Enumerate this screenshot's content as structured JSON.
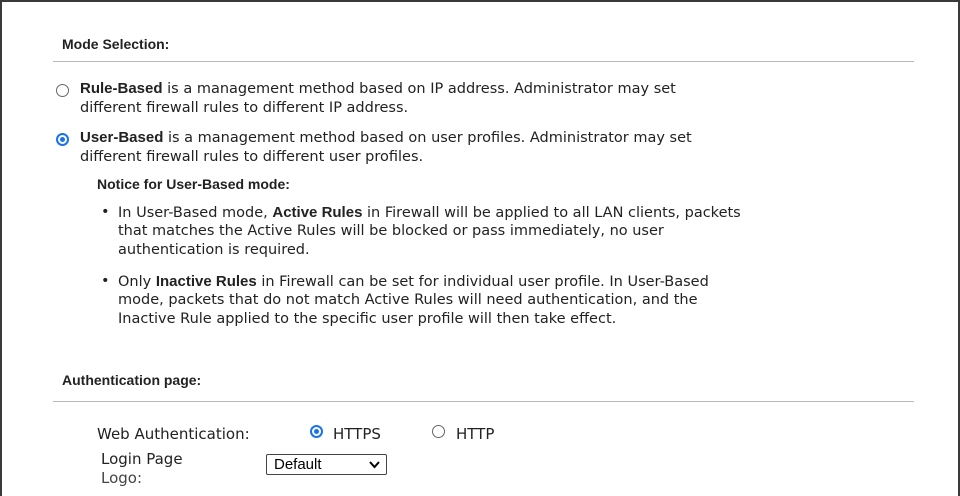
{
  "mode": {
    "title": "Mode Selection:",
    "rule_based": {
      "selected": false,
      "bold": "Rule-Based",
      "line1": " is a management method based on IP address. Administrator may set",
      "line2": "different firewall rules to different IP address."
    },
    "user_based": {
      "selected": true,
      "bold": "User-Based",
      "line1": " is a management method based on user profiles. Administrator may set",
      "line2": "different firewall rules to different user profiles."
    },
    "notice_title": "Notice for User-Based mode:",
    "bullets": [
      {
        "lines": [
          {
            "pre": "In User-Based mode, ",
            "bold": "Active Rules",
            "post": " in Firewall will be applied to all LAN clients, packets"
          },
          {
            "pre": "that matches the Active Rules will be blocked or pass immediately, no user",
            "bold": "",
            "post": ""
          },
          {
            "pre": "authentication is required.",
            "bold": "",
            "post": ""
          }
        ]
      },
      {
        "lines": [
          {
            "pre": "Only ",
            "bold": "Inactive Rules",
            "post": " in Firewall can be set for individual user profile. In User-Based"
          },
          {
            "pre": "mode, packets that do not match Active Rules will need authentication, and the",
            "bold": "",
            "post": ""
          },
          {
            "pre": "Inactive Rule applied to the specific user profile will then take effect.",
            "bold": "",
            "post": ""
          }
        ]
      }
    ]
  },
  "auth": {
    "title": "Authentication page:",
    "web_auth_label": "Web Authentication:",
    "options": [
      {
        "label": "HTTPS",
        "selected": true
      },
      {
        "label": "HTTP",
        "selected": false
      }
    ],
    "login_logo_label_1": "Login Page",
    "login_logo_label_2": "Logo:",
    "login_logo_value": "Default"
  },
  "colors": {
    "radio_accent": "#1a73e8",
    "divider": "#b8b8b8"
  }
}
